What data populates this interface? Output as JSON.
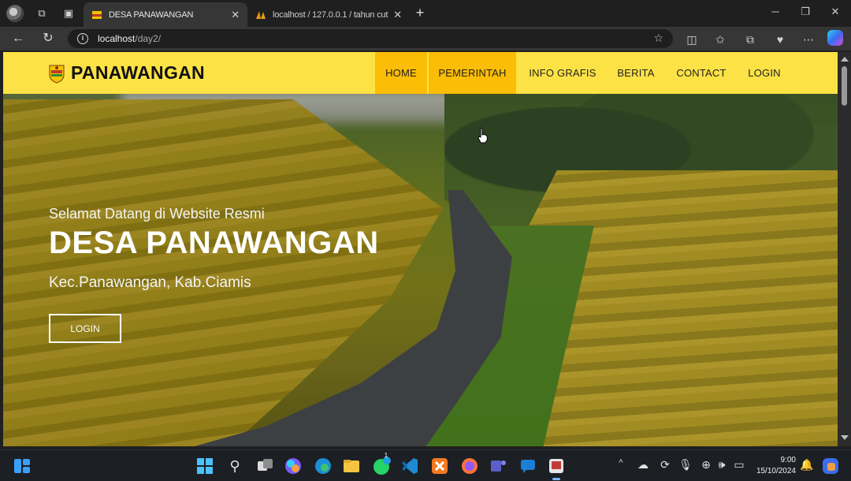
{
  "browser": {
    "tabs": [
      {
        "title": "DESA PANAWANGAN",
        "active": true
      },
      {
        "title": "localhost / 127.0.0.1 / tahun cuti",
        "active": false
      }
    ],
    "url_host": "localhost",
    "url_path": "/day2/"
  },
  "site": {
    "brand": "PANAWANGAN",
    "nav": [
      {
        "label": "HOME",
        "highlighted": true
      },
      {
        "label": "PEMERINTAH",
        "highlighted": true
      },
      {
        "label": "INFO GRAFIS",
        "highlighted": false
      },
      {
        "label": "BERITA",
        "highlighted": false
      },
      {
        "label": "CONTACT",
        "highlighted": false
      },
      {
        "label": "LOGIN",
        "highlighted": false
      }
    ],
    "hero": {
      "welcome": "Selamat Datang di Website Resmi",
      "headline": "DESA PANAWANGAN",
      "subtitle": "Kec.Panawangan, Kab.Ciamis",
      "button": "LOGIN"
    }
  },
  "colors": {
    "navbar": "#fde245",
    "nav_highlight": "#fbbd05"
  },
  "taskbar": {
    "time": "9:00",
    "date": "15/10/2024",
    "whatsapp_badge": "1"
  }
}
